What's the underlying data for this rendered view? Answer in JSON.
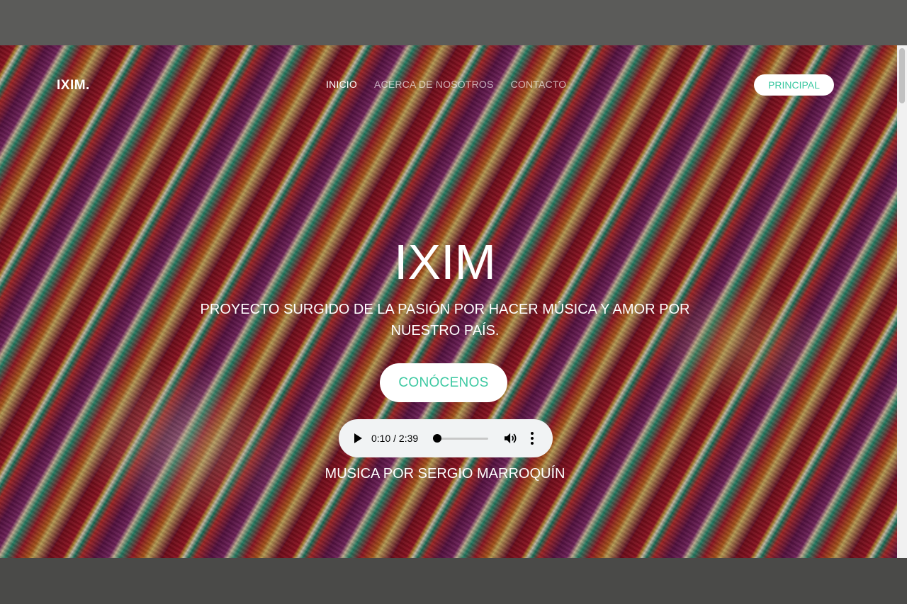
{
  "nav": {
    "brand": "IXIM.",
    "links": [
      "INICIO",
      "ACERCA DE NOSOTROS",
      "CONTACTO"
    ],
    "principal_label": "PRINCIPAL"
  },
  "hero": {
    "title": "IXIM",
    "subtitle": "PROYECTO SURGIDO DE LA PASIÓN POR HACER MÚSICA Y AMOR POR NUESTRO PAÍS.",
    "cta_label": "CONÓCENOS",
    "credit": "MUSICA POR SERGIO MARROQUÍN"
  },
  "audio": {
    "time_display": "0:10 / 2:39",
    "progress": 0.063
  },
  "colors": {
    "accent": "#3ec9a2",
    "text": "#ffffff"
  },
  "icons": {
    "play": "play-icon",
    "volume": "volume-icon",
    "more": "more-options-icon"
  }
}
